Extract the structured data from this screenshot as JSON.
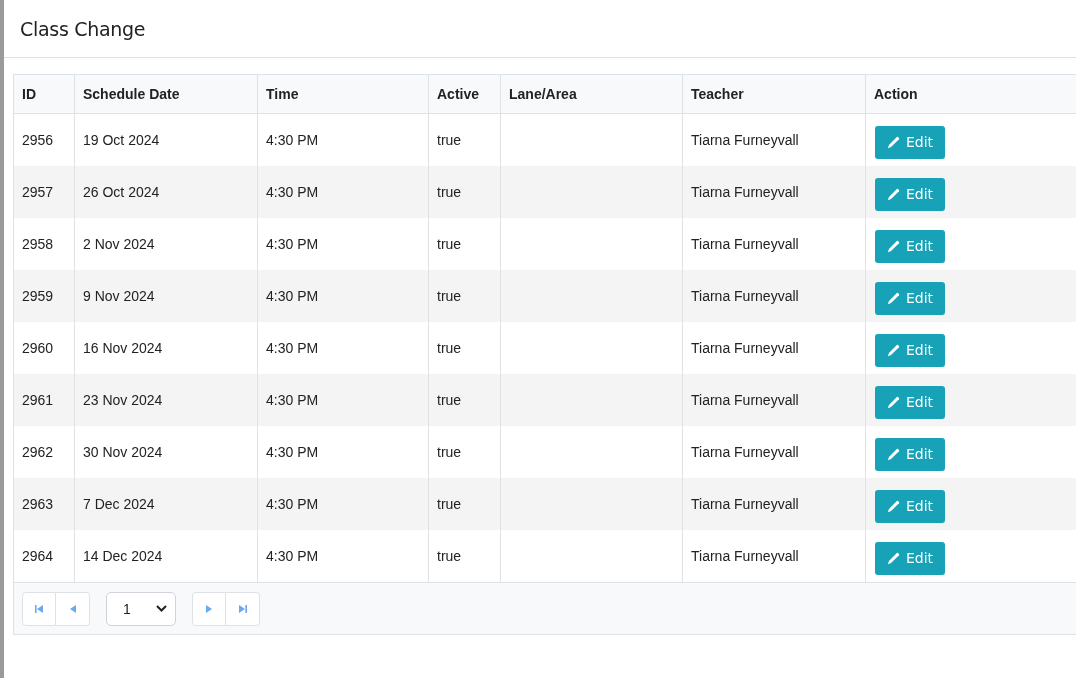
{
  "header": {
    "title": "Class Change"
  },
  "table": {
    "columns": [
      "ID",
      "Schedule Date",
      "Time",
      "Active",
      "Lane/Area",
      "Teacher",
      "Action"
    ],
    "rows": [
      {
        "id": "2956",
        "date": "19 Oct 2024",
        "time": "4:30 PM",
        "active": "true",
        "teacher": "Tiarna Furneyvall",
        "action": "Edit"
      },
      {
        "id": "2957",
        "date": "26 Oct 2024",
        "time": "4:30 PM",
        "active": "true",
        "teacher": "Tiarna Furneyvall",
        "action": "Edit"
      },
      {
        "id": "2958",
        "date": "2 Nov 2024",
        "time": "4:30 PM",
        "active": "true",
        "teacher": "Tiarna Furneyvall",
        "action": "Edit"
      },
      {
        "id": "2959",
        "date": "9 Nov 2024",
        "time": "4:30 PM",
        "active": "true",
        "teacher": "Tiarna Furneyvall",
        "action": "Edit"
      },
      {
        "id": "2960",
        "date": "16 Nov 2024",
        "time": "4:30 PM",
        "active": "true",
        "teacher": "Tiarna Furneyvall",
        "action": "Edit"
      },
      {
        "id": "2961",
        "date": "23 Nov 2024",
        "time": "4:30 PM",
        "active": "true",
        "teacher": "Tiarna Furneyvall",
        "action": "Edit"
      },
      {
        "id": "2962",
        "date": "30 Nov 2024",
        "time": "4:30 PM",
        "active": "true",
        "teacher": "Tiarna Furneyvall",
        "action": "Edit"
      },
      {
        "id": "2963",
        "date": "7 Dec 2024",
        "time": "4:30 PM",
        "active": "true",
        "teacher": "Tiarna Furneyvall",
        "action": "Edit"
      },
      {
        "id": "2964",
        "date": "14 Dec 2024",
        "time": "4:30 PM",
        "active": "true",
        "teacher": "Tiarna Furneyvall",
        "action": "Edit"
      }
    ]
  },
  "pager": {
    "page": "1"
  }
}
